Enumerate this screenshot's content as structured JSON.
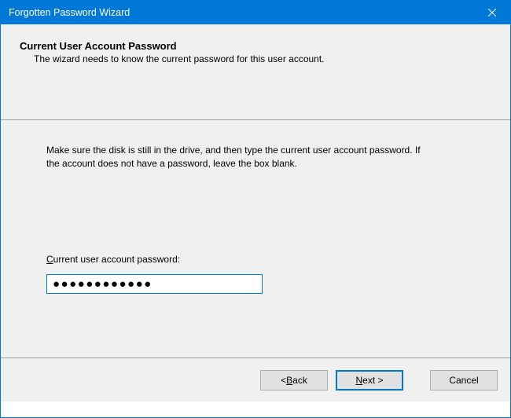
{
  "window": {
    "title": "Forgotten Password Wizard"
  },
  "header": {
    "title": "Current User Account Password",
    "subtitle": "The wizard needs to know the current password for this user account."
  },
  "content": {
    "instruction": "Make sure the disk is still in the drive, and then type the current user account password. If the account does not have a password, leave the box blank.",
    "field_label_pre": "C",
    "field_label_rest": "urrent user account password:",
    "password_value": "●●●●●●●●●●●●"
  },
  "buttons": {
    "back_pre": "< ",
    "back_mnemonic": "B",
    "back_post": "ack",
    "next_mnemonic": "N",
    "next_post": "ext >",
    "cancel": "Cancel"
  }
}
